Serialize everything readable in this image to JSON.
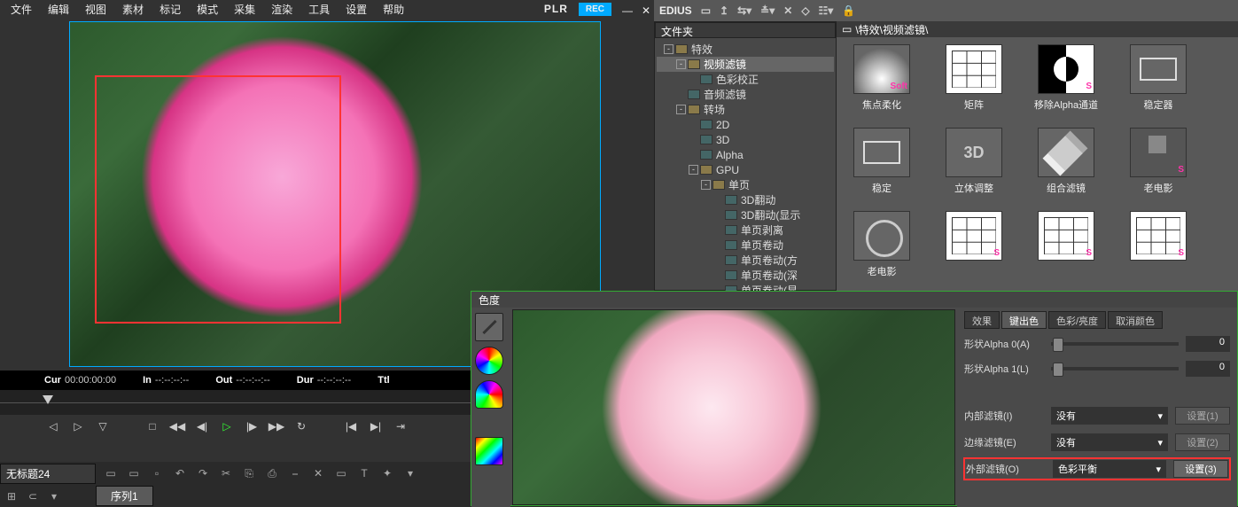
{
  "menu": {
    "items": [
      "文件",
      "编辑",
      "视图",
      "素材",
      "标记",
      "模式",
      "采集",
      "渲染",
      "工具",
      "设置",
      "帮助"
    ],
    "plr": "PLR",
    "rec": "REC"
  },
  "tc": {
    "cur_lbl": "Cur",
    "cur": "00:00:00:00",
    "in_lbl": "In",
    "in": "--:--:--:--",
    "out_lbl": "Out",
    "out": "--:--:--:--",
    "dur_lbl": "Dur",
    "dur": "--:--:--:--",
    "ttl_lbl": "Ttl"
  },
  "project_label": "无标题24",
  "sequence_tab": "序列1",
  "edius": {
    "brand": "EDIUS"
  },
  "tree": {
    "header": "文件夹",
    "nodes": [
      {
        "d": 0,
        "tg": "-",
        "t": "f",
        "lbl": "特效"
      },
      {
        "d": 1,
        "tg": "-",
        "t": "f",
        "lbl": "视频滤镜",
        "sel": true
      },
      {
        "d": 2,
        "tg": "",
        "t": "x",
        "lbl": "色彩校正"
      },
      {
        "d": 1,
        "tg": "",
        "t": "x",
        "lbl": "音频滤镜"
      },
      {
        "d": 1,
        "tg": "-",
        "t": "f",
        "lbl": "转场"
      },
      {
        "d": 2,
        "tg": "",
        "t": "x",
        "lbl": "2D"
      },
      {
        "d": 2,
        "tg": "",
        "t": "x",
        "lbl": "3D"
      },
      {
        "d": 2,
        "tg": "",
        "t": "x",
        "lbl": "Alpha"
      },
      {
        "d": 2,
        "tg": "-",
        "t": "f",
        "lbl": "GPU"
      },
      {
        "d": 3,
        "tg": "-",
        "t": "f",
        "lbl": "单页"
      },
      {
        "d": 4,
        "tg": "",
        "t": "x",
        "lbl": "3D翻动"
      },
      {
        "d": 4,
        "tg": "",
        "t": "x",
        "lbl": "3D翻动(显示"
      },
      {
        "d": 4,
        "tg": "",
        "t": "x",
        "lbl": "单页剥离"
      },
      {
        "d": 4,
        "tg": "",
        "t": "x",
        "lbl": "单页卷动"
      },
      {
        "d": 4,
        "tg": "",
        "t": "x",
        "lbl": "单页卷动(方"
      },
      {
        "d": 4,
        "tg": "",
        "t": "x",
        "lbl": "单页卷动(深"
      },
      {
        "d": 4,
        "tg": "",
        "t": "x",
        "lbl": "单页卷动(显"
      }
    ]
  },
  "crumb": "\\特效\\视频滤镜\\",
  "effects": [
    {
      "lbl": "焦点柔化",
      "cls": "soft",
      "tag": "Soft"
    },
    {
      "lbl": "矩阵",
      "cls": "matrix"
    },
    {
      "lbl": "移除Alpha通道",
      "cls": "alpha",
      "tag": "S"
    },
    {
      "lbl": "稳定器",
      "cls": "stab"
    },
    {
      "lbl": "稳定",
      "cls": "stab"
    },
    {
      "lbl": "立体调整",
      "cls": "t3d",
      "txt": "3D"
    },
    {
      "lbl": "组合滤镜",
      "cls": "layers"
    },
    {
      "lbl": "老电影",
      "cls": "film",
      "tag": "S"
    },
    {
      "lbl": "老电影",
      "cls": "reel"
    },
    {
      "lbl": "",
      "cls": "matrix",
      "tag": "S"
    },
    {
      "lbl": "",
      "cls": "matrix",
      "tag": "S"
    },
    {
      "lbl": "",
      "cls": "matrix",
      "tag": "S"
    },
    {
      "lbl": "",
      "cls": "matrix"
    }
  ],
  "chroma": {
    "title": "色度",
    "tabs": [
      "效果",
      "键出色",
      "色彩/亮度",
      "取消颜色"
    ],
    "active_tab": 1,
    "alpha0_lbl": "形状Alpha 0(A)",
    "alpha0_val": "0",
    "alpha1_lbl": "形状Alpha 1(L)",
    "alpha1_val": "0",
    "inner_lbl": "内部滤镜(I)",
    "inner_val": "没有",
    "inner_btn": "设置(1)",
    "edge_lbl": "边缘滤镜(E)",
    "edge_val": "没有",
    "edge_btn": "设置(2)",
    "outer_lbl": "外部滤镜(O)",
    "outer_val": "色彩平衡",
    "outer_btn": "设置(3)"
  }
}
